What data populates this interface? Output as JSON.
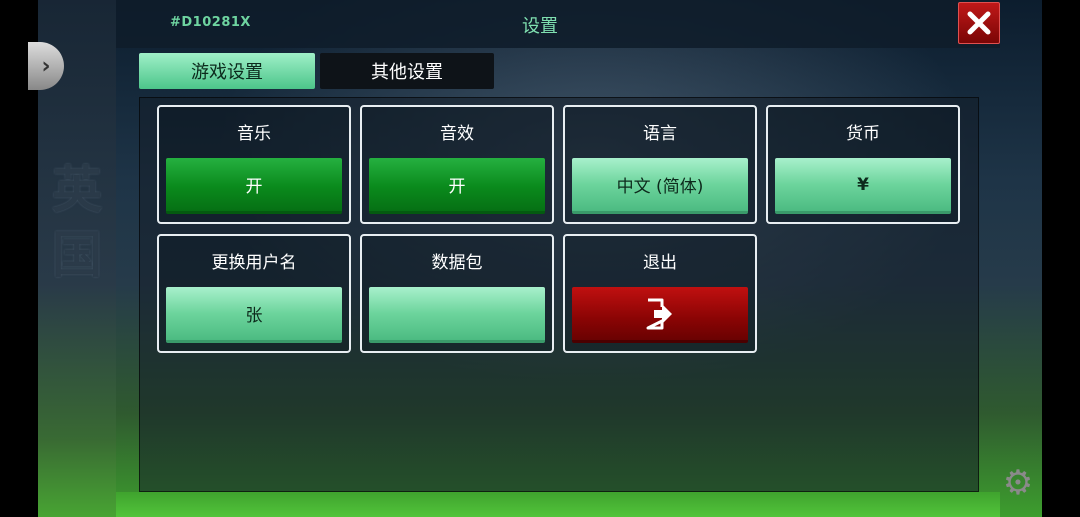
{
  "header": {
    "player_id": "#D10281X",
    "title": "设置",
    "close_icon": "close-x-icon"
  },
  "background": {
    "side_text_1": "英",
    "side_text_2": "国"
  },
  "tabs": [
    {
      "label": "游戏设置",
      "active": true
    },
    {
      "label": "其他设置",
      "active": false
    }
  ],
  "settings": [
    {
      "label": "音乐",
      "value": "开",
      "style": "green"
    },
    {
      "label": "音效",
      "value": "开",
      "style": "green"
    },
    {
      "label": "语言",
      "value": "中文 (简体)",
      "style": "mint"
    },
    {
      "label": "货币",
      "value": "¥",
      "style": "mint"
    },
    {
      "label": "更换用户名",
      "value": "张",
      "style": "mint"
    },
    {
      "label": "数据包",
      "value": "",
      "style": "mint"
    },
    {
      "label": "退出",
      "value": "",
      "style": "red",
      "icon": "exit-icon"
    }
  ],
  "colors": {
    "accent_green": "#0a8a1c",
    "mint": "#6cd49c",
    "danger_red": "#8a0404",
    "title_color": "#7fe0b0"
  }
}
